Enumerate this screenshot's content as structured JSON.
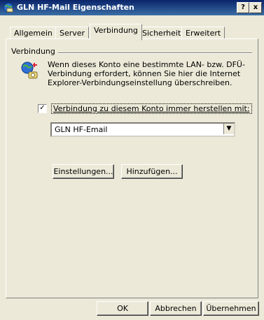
{
  "window": {
    "title": "GLN HF-Mail Eigenschaften",
    "help_label": "?",
    "close_label": "x"
  },
  "tabs": [
    {
      "label": "Allgemein"
    },
    {
      "label": "Server"
    },
    {
      "label": "Verbindung",
      "active": true
    },
    {
      "label": "Sicherheit"
    },
    {
      "label": "Erweitert"
    }
  ],
  "connection": {
    "group_label": "Verbindung",
    "description": "Wenn dieses Konto eine bestimmte LAN- bzw. DFÜ-Verbindung erfordert, können Sie hier die Internet Explorer-Verbindungseinstellung überschreiben.",
    "checkbox_label": "Verbindung zu diesem Konto immer herstellen mit:",
    "checkbox_checked": true,
    "checkbox_mark": "✓",
    "selected_connection": "GLN HF-Email",
    "select_arrow": "▼",
    "settings_button": "Einstellungen...",
    "add_button": "Hinzufügen..."
  },
  "footer": {
    "ok": "OK",
    "cancel": "Abbrechen",
    "apply": "Übernehmen"
  },
  "icons": {
    "app": "mail-globe-icon",
    "network": "network-globe-icon"
  }
}
